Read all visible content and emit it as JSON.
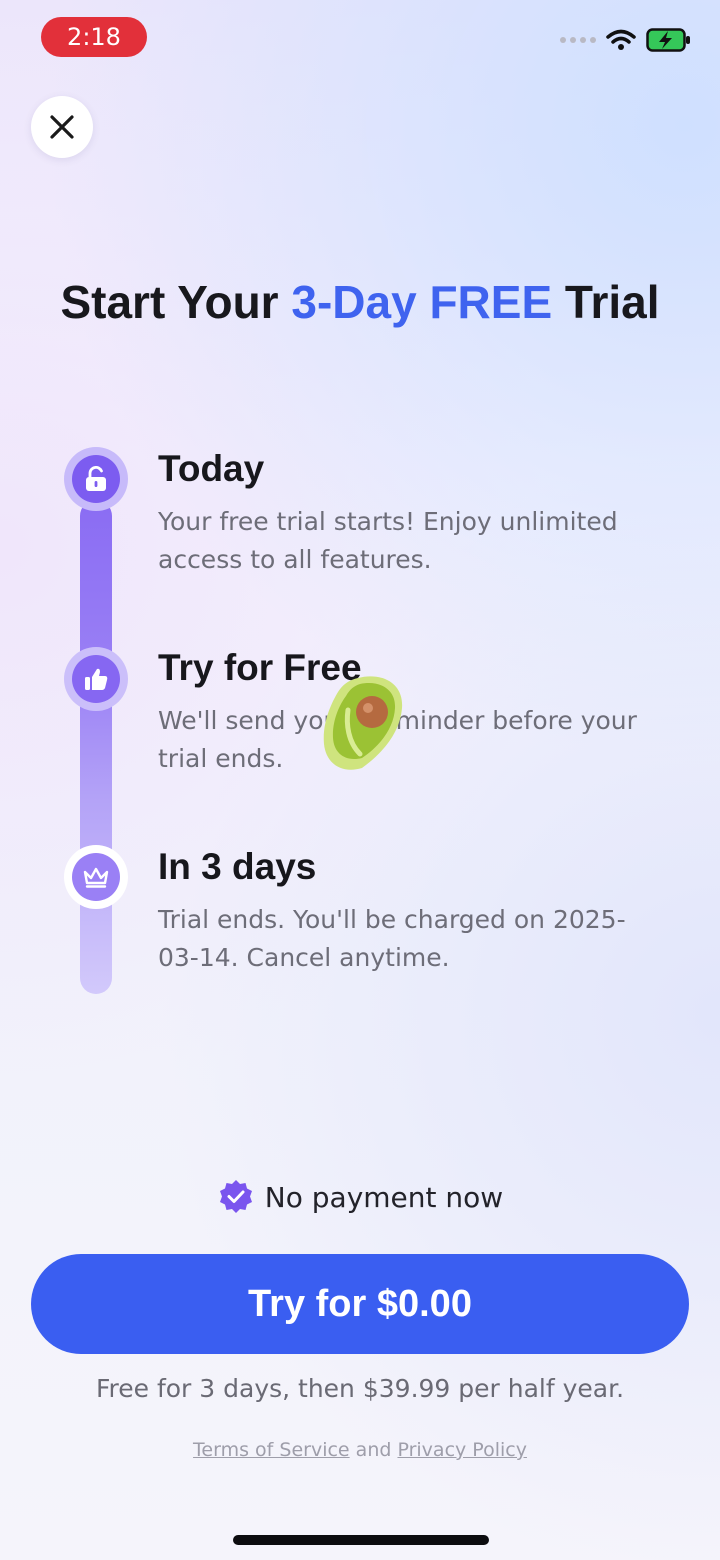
{
  "status_bar": {
    "time": "2:18",
    "icons": [
      "signal-dots-icon",
      "wifi-icon",
      "battery-charging-icon"
    ]
  },
  "close_button": {
    "icon": "close-icon"
  },
  "headline": {
    "prefix": "Start Your ",
    "highlight": "3-Day FREE",
    "suffix": " Trial",
    "accent_color": "#3f63ef"
  },
  "timeline": {
    "track_color": "#8a6cf3",
    "steps": [
      {
        "icon": "unlock-icon",
        "title": "Today",
        "description": "Your free trial starts! Enjoy unlimited access to all features."
      },
      {
        "icon": "thumbs-up-icon",
        "title": "Try for Free",
        "description": "We'll send you a reminder before your trial ends."
      },
      {
        "icon": "crown-icon",
        "title": "In 3 days",
        "description": "Trial ends. You'll be charged on 2025-03-14. Cancel anytime."
      }
    ]
  },
  "no_payment": {
    "icon": "verified-check-icon",
    "label": "No payment now",
    "icon_color": "#7a55ee"
  },
  "cta": {
    "label": "Try for $0.00",
    "color": "#3a5ef1"
  },
  "price_note": "Free for 3 days, then $39.99 per half year.",
  "legal": {
    "terms": "Terms of Service",
    "and": "and",
    "privacy": "Privacy Policy"
  }
}
